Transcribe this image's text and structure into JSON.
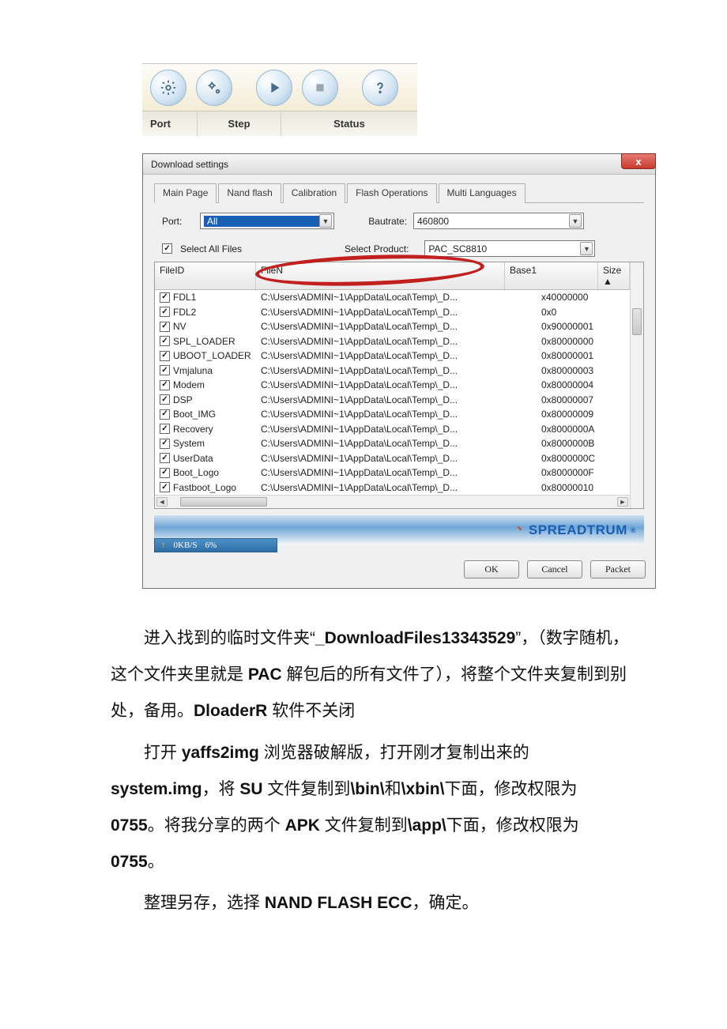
{
  "toolbar": {
    "header": {
      "port": "Port",
      "step": "Step",
      "status": "Status"
    }
  },
  "dialog": {
    "title": "Download settings",
    "close_label": "x",
    "tabs": [
      "Main Page",
      "Nand flash",
      "Calibration",
      "Flash Operations",
      "Multi Languages"
    ],
    "port_label": "Port:",
    "port_value": "All",
    "baud_label": "Bautrate:",
    "baud_value": "460800",
    "select_all_label": "Select All Files",
    "select_product_label": "Select Product:",
    "select_product_value": "PAC_SC8810",
    "grid": {
      "headers": {
        "fileid": "FileID",
        "filename_partial": "FileN",
        "base1": "Base1",
        "size": "Size"
      },
      "rows": [
        {
          "checked": true,
          "id": "FDL1",
          "path": "C:\\Users\\ADMINI~1\\AppData\\Local\\Temp\\_D...",
          "base": "x40000000"
        },
        {
          "checked": true,
          "id": "FDL2",
          "path": "C:\\Users\\ADMINI~1\\AppData\\Local\\Temp\\_D...",
          "base": "0x0"
        },
        {
          "checked": true,
          "id": "NV",
          "path": "C:\\Users\\ADMINI~1\\AppData\\Local\\Temp\\_D...",
          "base": "0x90000001"
        },
        {
          "checked": true,
          "id": "SPL_LOADER",
          "path": "C:\\Users\\ADMINI~1\\AppData\\Local\\Temp\\_D...",
          "base": "0x80000000"
        },
        {
          "checked": true,
          "id": "UBOOT_LOADER",
          "path": "C:\\Users\\ADMINI~1\\AppData\\Local\\Temp\\_D...",
          "base": "0x80000001"
        },
        {
          "checked": true,
          "id": "Vmjaluna",
          "path": "C:\\Users\\ADMINI~1\\AppData\\Local\\Temp\\_D...",
          "base": "0x80000003"
        },
        {
          "checked": true,
          "id": "Modem",
          "path": "C:\\Users\\ADMINI~1\\AppData\\Local\\Temp\\_D...",
          "base": "0x80000004"
        },
        {
          "checked": true,
          "id": "DSP",
          "path": "C:\\Users\\ADMINI~1\\AppData\\Local\\Temp\\_D...",
          "base": "0x80000007"
        },
        {
          "checked": true,
          "id": "Boot_IMG",
          "path": "C:\\Users\\ADMINI~1\\AppData\\Local\\Temp\\_D...",
          "base": "0x80000009"
        },
        {
          "checked": true,
          "id": "Recovery",
          "path": "C:\\Users\\ADMINI~1\\AppData\\Local\\Temp\\_D...",
          "base": "0x8000000A"
        },
        {
          "checked": true,
          "id": "System",
          "path": "C:\\Users\\ADMINI~1\\AppData\\Local\\Temp\\_D...",
          "base": "0x8000000B"
        },
        {
          "checked": true,
          "id": "UserData",
          "path": "C:\\Users\\ADMINI~1\\AppData\\Local\\Temp\\_D...",
          "base": "0x8000000C"
        },
        {
          "checked": true,
          "id": "Boot_Logo",
          "path": "C:\\Users\\ADMINI~1\\AppData\\Local\\Temp\\_D...",
          "base": "0x8000000F"
        },
        {
          "checked": true,
          "id": "Fastboot_Logo",
          "path": "C:\\Users\\ADMINI~1\\AppData\\Local\\Temp\\_D...",
          "base": "0x80000010"
        }
      ]
    },
    "brand": "SPREADTRUM",
    "status": {
      "speed": "0KB/S",
      "percent": "6%"
    },
    "buttons": {
      "ok": "OK",
      "cancel": "Cancel",
      "packet": "Packet"
    }
  },
  "article": {
    "p1a": "进入找到的临时文件夹“",
    "p1b": "_DownloadFiles13343529",
    "p1c": "”，（数字随机，这个文件夹里就是 ",
    "p1d": "PAC",
    "p1e": " 解包后的所有文件了），将整个文件夹复制到别处，备用。",
    "p1f": "DloaderR",
    "p1g": " 软件不关闭",
    "p2a": "打开 ",
    "p2b": "yaffs2img",
    "p2c": " 浏览器破解版，打开刚才复制出来的 ",
    "p2d": "system.img",
    "p2e": "，将 ",
    "p2f": "SU",
    "p2g": " 文件复制到",
    "p2h": "\\bin\\",
    "p2i": "和",
    "p2j": "\\xbin\\",
    "p2k": "下面，修改权限为 ",
    "p2l": "0755",
    "p2m": "。将我分享的两个 ",
    "p2n": "APK",
    "p2o": " 文件复制到",
    "p2p": "\\app\\",
    "p2q": "下面，修改权限为 ",
    "p2r": "0755",
    "p2s": "。",
    "p3a": "整理另存，选择 ",
    "p3b": "NAND FLASH ECC",
    "p3c": "，确定。"
  }
}
